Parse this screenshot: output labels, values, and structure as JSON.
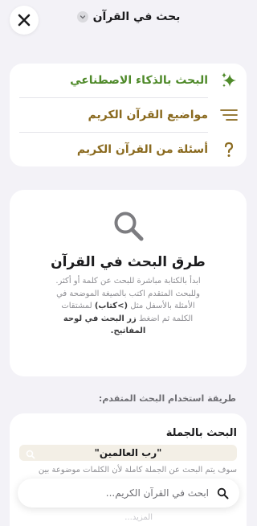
{
  "header": {
    "title": "بحث في القرآن",
    "close_icon": "close-icon",
    "dropdown_icon": "chevron-down-icon"
  },
  "menu": {
    "items": [
      {
        "label": "البحث بالذكاء الاصطناعي",
        "icon": "sparkles-icon",
        "color": "#4f8a2a"
      },
      {
        "label": "مواضيع القرآن الكريم",
        "icon": "lines-icon",
        "color": "#8a6a1f"
      },
      {
        "label": "أسئلة من القرآن الكريم",
        "icon": "question-icon",
        "color": "#8a6a1f"
      }
    ]
  },
  "info": {
    "title": "طرق البحث في القرآن",
    "line1": "ابدأ بالكتابة مباشرة للبحث عن كلمة أو أكثر.",
    "line2": "وللبحث المتقدم اكتب بالصيغة الموضحة في",
    "line3_a": "الأمثلة بالأسفل مثل",
    "line3_b": "(>كتاب)",
    "line3_c": "لمشتقات",
    "line4_a": "الكلمة ثم اضغط",
    "line4_b": "زر البحث في لوحة",
    "line5": "المفاتيح."
  },
  "advanced": {
    "heading": "طريقة استخدام البحث المتقدم:",
    "card_title": "البحث بالجملة",
    "example": "\"رب العالمين\"",
    "description": "سوف يتم البحث عن الجملة كاملة لأن الكلمات موضوعة بين",
    "more": "المزيد..."
  },
  "search": {
    "placeholder": "ابحث في القرآن الكريم..."
  },
  "colors": {
    "background": "#f3f2f7",
    "accent_green": "#4f8a2a",
    "accent_gold": "#8a6a1f"
  }
}
